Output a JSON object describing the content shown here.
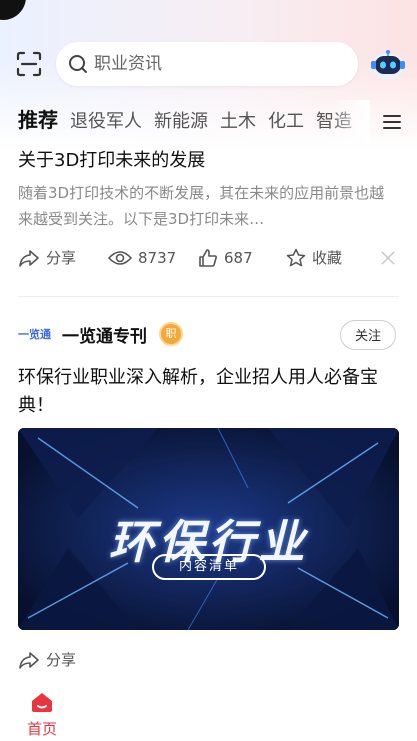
{
  "search": {
    "placeholder": "职业资讯"
  },
  "tabs": [
    {
      "label": "推荐",
      "active": true
    },
    {
      "label": "退役军人"
    },
    {
      "label": "新能源"
    },
    {
      "label": "土木"
    },
    {
      "label": "化工"
    },
    {
      "label": "智造"
    }
  ],
  "article1": {
    "title": "关于3D打印未来的发展",
    "summary": "随着3D打印技术的不断发展，其在未来的应用前景也越来越受到关注。以下是3D打印未来…",
    "share_label": "分享",
    "views": "8737",
    "likes": "687",
    "favorite_label": "收藏"
  },
  "article2": {
    "channel_logo": "一览通",
    "channel_name": "一览通专刊",
    "channel_badge": "职",
    "follow_label": "关注",
    "title": "环保行业职业深入解析，企业招人用人必备宝典！",
    "banner_title": "环保行业",
    "banner_subtitle": "内容清单",
    "share_label": "分享"
  },
  "bottom_nav": {
    "home_label": "首页"
  },
  "colors": {
    "accent": "#e8363f",
    "banner_bg": "#0b1638"
  }
}
